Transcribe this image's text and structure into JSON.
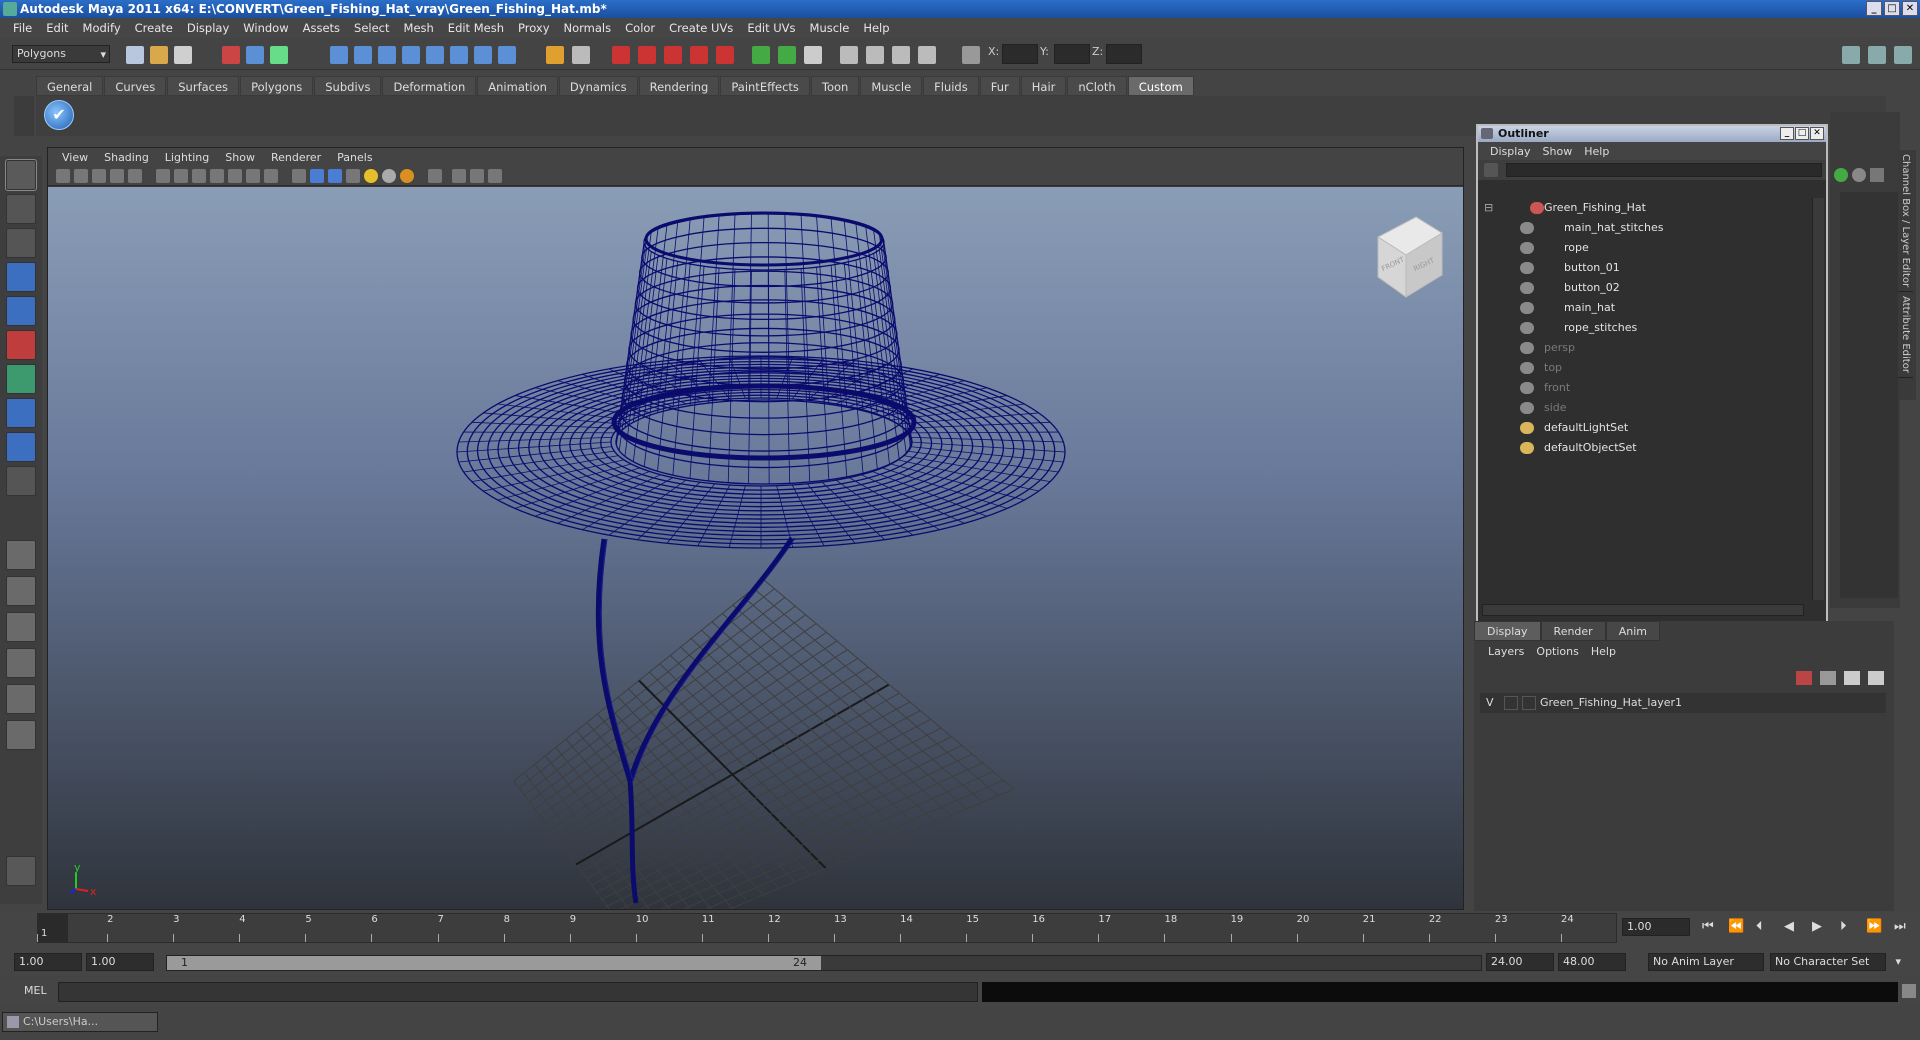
{
  "window": {
    "title": "Autodesk Maya 2011 x64: E:\\CONVERT\\Green_Fishing_Hat_vray\\Green_Fishing_Hat.mb*"
  },
  "menubar": [
    "File",
    "Edit",
    "Modify",
    "Create",
    "Display",
    "Window",
    "Assets",
    "Select",
    "Mesh",
    "Edit Mesh",
    "Proxy",
    "Normals",
    "Color",
    "Create UVs",
    "Edit UVs",
    "Muscle",
    "Help"
  ],
  "status": {
    "mode": "Polygons",
    "x_label": "X:",
    "y_label": "Y:",
    "z_label": "Z:"
  },
  "shelf": {
    "tabs": [
      "General",
      "Curves",
      "Surfaces",
      "Polygons",
      "Subdivs",
      "Deformation",
      "Animation",
      "Dynamics",
      "Rendering",
      "PaintEffects",
      "Toon",
      "Muscle",
      "Fluids",
      "Fur",
      "Hair",
      "nCloth",
      "Custom"
    ],
    "active": "Custom"
  },
  "viewport": {
    "menu": [
      "View",
      "Shading",
      "Lighting",
      "Show",
      "Renderer",
      "Panels"
    ],
    "viewcube": {
      "front": "FRONT",
      "right": "RIGHT"
    },
    "axis": {
      "y": "y",
      "x": "x",
      "z": "z"
    }
  },
  "outliner": {
    "title": "Outliner",
    "menu": [
      "Display",
      "Show",
      "Help"
    ],
    "items": [
      {
        "label": "Green_Fishing_Hat",
        "indent": 0,
        "dim": false
      },
      {
        "label": "main_hat_stitches",
        "indent": 1,
        "dim": false
      },
      {
        "label": "rope",
        "indent": 1,
        "dim": false
      },
      {
        "label": "button_01",
        "indent": 1,
        "dim": false
      },
      {
        "label": "button_02",
        "indent": 1,
        "dim": false
      },
      {
        "label": "main_hat",
        "indent": 1,
        "dim": false
      },
      {
        "label": "rope_stitches",
        "indent": 1,
        "dim": false
      },
      {
        "label": "persp",
        "indent": 0,
        "dim": true
      },
      {
        "label": "top",
        "indent": 0,
        "dim": true
      },
      {
        "label": "front",
        "indent": 0,
        "dim": true
      },
      {
        "label": "side",
        "indent": 0,
        "dim": true
      },
      {
        "label": "defaultLightSet",
        "indent": 0,
        "dim": false
      },
      {
        "label": "defaultObjectSet",
        "indent": 0,
        "dim": false
      }
    ]
  },
  "side_tabs": [
    "Channel Box / Layer Editor",
    "Attribute Editor"
  ],
  "layers": {
    "tabs": [
      "Display",
      "Render",
      "Anim"
    ],
    "active": "Display",
    "menu": [
      "Layers",
      "Options",
      "Help"
    ],
    "rows": [
      {
        "visible": "V",
        "name": "Green_Fishing_Hat_layer1"
      }
    ]
  },
  "timeline": {
    "ticks": [
      "1",
      "2",
      "3",
      "4",
      "5",
      "6",
      "7",
      "8",
      "9",
      "10",
      "11",
      "12",
      "13",
      "14",
      "15",
      "16",
      "17",
      "18",
      "19",
      "20",
      "21",
      "22",
      "23",
      "24"
    ],
    "start_marker": "1",
    "current_frame": "1.00"
  },
  "range": {
    "start": "1.00",
    "playback_start": "1.00",
    "slider_start": "1",
    "slider_end": "24",
    "playback_end": "24.00",
    "end": "48.00",
    "anim_layer": "No Anim Layer",
    "character_set": "No Character Set"
  },
  "command": {
    "label": "MEL"
  },
  "taskbar": {
    "item": "C:\\Users\\Ha..."
  },
  "colors": {
    "wire": "#0b0b6e",
    "grid": "#3a3a3a",
    "title_blue": "#2a6fc9"
  }
}
